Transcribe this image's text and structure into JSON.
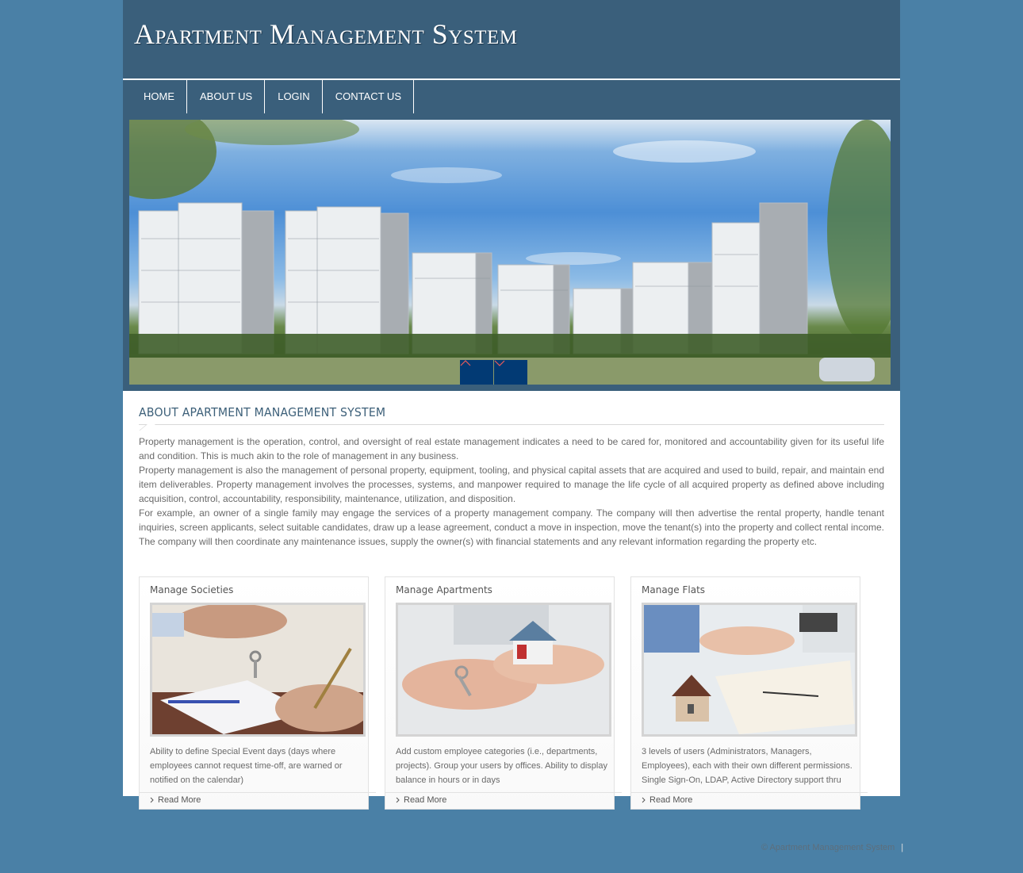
{
  "header": {
    "title": "Apartment Management System"
  },
  "nav": {
    "items": [
      {
        "label": "HOME"
      },
      {
        "label": "ABOUT US"
      },
      {
        "label": "LOGIN"
      },
      {
        "label": "CONTACT US"
      }
    ]
  },
  "banner": {
    "alt": "Apartment towers with trees and blue sky",
    "prev_icon": "chevron-up-icon",
    "next_icon": "chevron-down-icon"
  },
  "about": {
    "title": "ABOUT APARTMENT MANAGEMENT SYSTEM",
    "paragraphs": [
      "Property management is the operation, control, and oversight of real estate management indicates a need to be cared for, monitored and accountability given for its useful life and condition. This is much akin to the role of management in any business.",
      "Property management is also the management of personal property, equipment, tooling, and physical capital assets that are acquired and used to build, repair, and maintain end item deliverables. Property management involves the processes, systems, and manpower required to manage the life cycle of all acquired property as defined above including acquisition, control, accountability, responsibility, maintenance, utilization, and disposition.",
      "For example, an owner of a single family may engage the services of a property management company. The company will then advertise the rental property, handle tenant inquiries, screen applicants, select suitable candidates, draw up a lease agreement, conduct a move in inspection, move the tenant(s) into the property and collect rental income. The company will then coordinate any maintenance issues, supply the owner(s) with financial statements and any relevant information regarding the property etc."
    ]
  },
  "cards": [
    {
      "title": "Manage Societies",
      "image": "hand-giving-keys-over-contract",
      "description": "Ability to define Special Event days (days where employees cannot request time-off, are warned or notified on the calendar)",
      "link": "Read More"
    },
    {
      "title": "Manage Apartments",
      "image": "hands-holding-house-and-keys",
      "description": "Add custom employee categories (i.e., departments, projects). Group your users by offices. Ability to display balance in hours or in days",
      "link": "Read More"
    },
    {
      "title": "Manage Flats",
      "image": "handshake-over-house-model",
      "description": "3 levels of users (Administrators, Managers, Employees), each with their own different permissions. Single Sign-On, LDAP, Active Directory support thru",
      "link": "Read More"
    }
  ],
  "footer": {
    "copyright": "© Apartment Management System",
    "separator": "|"
  },
  "colors": {
    "page_bg": "#4a80a6",
    "header_bg": "#3a5f7b",
    "slider_button": "#023a74",
    "heading": "#3d6079"
  }
}
